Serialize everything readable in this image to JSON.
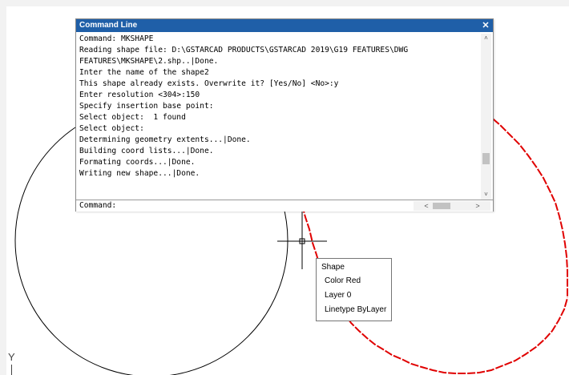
{
  "command_window": {
    "title": "Command Line",
    "close_label": "✕",
    "history": [
      "Command: MKSHAPE",
      "Reading shape file: D:\\GSTARCAD PRODUCTS\\GSTARCAD 2019\\G19 FEATURES\\DWG",
      "FEATURES\\MKSHAPE\\2.shp..|Done.",
      "Inter the name of the shape2",
      "This shape already exists. Overwrite it? [Yes/No] <No>:y",
      "Enter resolution <304>:150",
      "Specify insertion base point:",
      "Select object:  1 found",
      "Select object:",
      "Determining geometry extents...|Done.",
      "Building coord lists...|Done.",
      "Formating coords...|Done.",
      "Writing new shape...|Done."
    ],
    "prompt": "Command:",
    "scroll_up": "˄",
    "scroll_down": "˅",
    "scroll_left": "<",
    "scroll_right": ">"
  },
  "tooltip": {
    "title": "Shape",
    "rows": [
      "Color Red",
      "Layer 0",
      "Linetype ByLayer"
    ]
  },
  "ucs": {
    "y_label": "Y"
  },
  "colors": {
    "titlebar": "#1f5fa8",
    "shape_red": "#e00000",
    "circle_black": "#000000"
  }
}
